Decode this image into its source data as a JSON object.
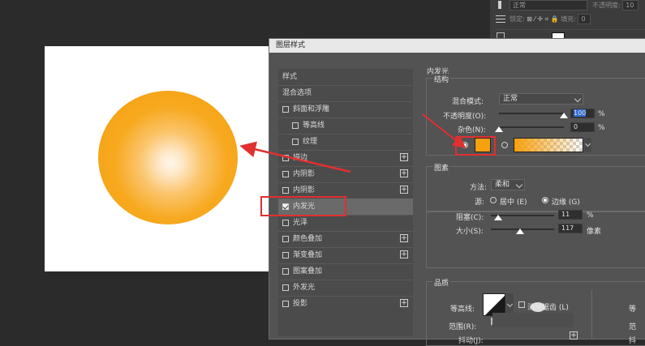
{
  "canvas": {
    "orb_colors": {
      "edge": "#f59f0d",
      "center": "#fff7ea"
    }
  },
  "top_panel": {
    "blend_value": "正常",
    "opacity_label": "不透明度:",
    "opacity_value": "10",
    "lock_label": "锁定:",
    "lock_icons": "⊠ ⁄ ✛ ⌗ 🔒",
    "fill_label": "填充:",
    "fill_value": "0"
  },
  "dialog": {
    "title": "图层样式",
    "left_items": [
      {
        "label": "样式",
        "checkbox": false,
        "plus": false,
        "checked": false
      },
      {
        "label": "混合选项",
        "checkbox": false,
        "plus": false,
        "checked": false
      },
      {
        "label": "斜面和浮雕",
        "checkbox": true,
        "plus": false,
        "checked": false
      },
      {
        "label": "等高线",
        "checkbox": true,
        "plus": false,
        "checked": false,
        "indent": true
      },
      {
        "label": "纹理",
        "checkbox": true,
        "plus": false,
        "checked": false,
        "indent": true
      },
      {
        "label": "描边",
        "checkbox": true,
        "plus": true,
        "checked": false
      },
      {
        "label": "内阴影",
        "checkbox": true,
        "plus": true,
        "checked": false
      },
      {
        "label": "内阴影",
        "checkbox": true,
        "plus": true,
        "checked": false
      },
      {
        "label": "内发光",
        "checkbox": true,
        "plus": false,
        "checked": true,
        "selected": true
      },
      {
        "label": "光泽",
        "checkbox": true,
        "plus": false,
        "checked": false
      },
      {
        "label": "颜色叠加",
        "checkbox": true,
        "plus": true,
        "checked": false
      },
      {
        "label": "渐变叠加",
        "checkbox": true,
        "plus": true,
        "checked": false
      },
      {
        "label": "图案叠加",
        "checkbox": true,
        "plus": false,
        "checked": false
      },
      {
        "label": "外发光",
        "checkbox": true,
        "plus": false,
        "checked": false
      },
      {
        "label": "投影",
        "checkbox": true,
        "plus": true,
        "checked": false
      }
    ],
    "panel": {
      "section_title": "内发光",
      "structure": {
        "title": "结构",
        "blend_mode_label": "混合模式:",
        "blend_mode_value": "正常",
        "opacity_label": "不透明度(O):",
        "opacity_value": "100",
        "opacity_unit": "%",
        "opacity_level": 1.0,
        "noise_label": "杂色(N):",
        "noise_value": "0",
        "noise_unit": "%",
        "noise_level": 0.0,
        "glow_color": "#f7a00d",
        "gradient_from": "#f7a00d"
      },
      "elements": {
        "title": "图素",
        "method_label": "方法:",
        "method_value": "柔和",
        "source_label": "源:",
        "source_center": "居中 (E)",
        "source_edge": "边缘 (G)",
        "choke_label": "阻塞(C):",
        "choke_value": "11",
        "choke_unit": "%",
        "choke_level": 0.11,
        "size_label": "大小(S):",
        "size_value": "117",
        "size_unit": "像素",
        "size_level": 0.46
      },
      "quality": {
        "title": "品质",
        "contour_label": "等高线:",
        "antialias_label": "消除锯齿 (L)",
        "range_label": "范围(R):",
        "jitter_label": "抖动(J):",
        "side_label_1": "等",
        "side_label_2": "范",
        "side_label_3": "抖"
      }
    }
  },
  "annotations": {
    "color": "#e03030"
  }
}
